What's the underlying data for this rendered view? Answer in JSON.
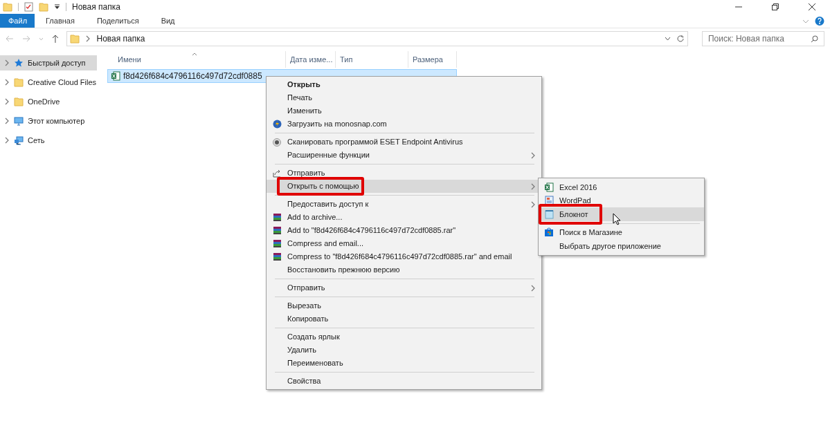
{
  "window": {
    "title": "Новая папка"
  },
  "ribbon_tabs": [
    {
      "label": "Файл",
      "selected": true
    },
    {
      "label": "Главная",
      "selected": false
    },
    {
      "label": "Поделиться",
      "selected": false
    },
    {
      "label": "Вид",
      "selected": false
    }
  ],
  "address": {
    "path": "Новая папка"
  },
  "search": {
    "placeholder": "Поиск: Новая папка"
  },
  "sidebar": {
    "items": [
      {
        "label": "Быстрый доступ",
        "selected": true
      },
      {
        "label": "Creative Cloud Files",
        "selected": false
      },
      {
        "label": "OneDrive",
        "selected": false
      },
      {
        "label": "Этот компьютер",
        "selected": false
      },
      {
        "label": "Сеть",
        "selected": false
      }
    ]
  },
  "table": {
    "columns": [
      "Имени",
      "Дата изме...",
      "Тип",
      "Размера"
    ],
    "rows": [
      {
        "name": "f8d426f684c4796116c497d72cdf0885",
        "selected": true
      }
    ]
  },
  "context_menu": {
    "items": [
      {
        "kind": "item",
        "label": "Открыть",
        "default": true,
        "selected": false,
        "submenu": false,
        "highlighted": false
      },
      {
        "kind": "item",
        "label": "Печать",
        "default": false,
        "selected": false,
        "submenu": false,
        "highlighted": false
      },
      {
        "kind": "item",
        "label": "Изменить",
        "default": false,
        "selected": false,
        "submenu": false,
        "highlighted": false
      },
      {
        "kind": "item",
        "label": "Загрузить на monosnap.com",
        "default": false,
        "selected": false,
        "submenu": false,
        "highlighted": false
      },
      {
        "kind": "separator"
      },
      {
        "kind": "item",
        "label": "Сканировать программой ESET Endpoint Antivirus",
        "default": false,
        "selected": false,
        "submenu": false,
        "highlighted": false
      },
      {
        "kind": "item",
        "label": "Расширенные функции",
        "default": false,
        "selected": false,
        "submenu": true,
        "highlighted": false
      },
      {
        "kind": "separator"
      },
      {
        "kind": "item",
        "label": "Отправить",
        "default": false,
        "selected": false,
        "submenu": false,
        "highlighted": false
      },
      {
        "kind": "item",
        "label": "Открыть с помощью",
        "default": false,
        "selected": true,
        "submenu": true,
        "highlighted": true
      },
      {
        "kind": "separator"
      },
      {
        "kind": "item",
        "label": "Предоставить доступ к",
        "default": false,
        "selected": false,
        "submenu": true,
        "highlighted": false
      },
      {
        "kind": "item",
        "label": "Add to archive...",
        "default": false,
        "selected": false,
        "submenu": false,
        "highlighted": false
      },
      {
        "kind": "item",
        "label": "Add to \"f8d426f684c4796116c497d72cdf0885.rar\"",
        "default": false,
        "selected": false,
        "submenu": false,
        "highlighted": false
      },
      {
        "kind": "item",
        "label": "Compress and email...",
        "default": false,
        "selected": false,
        "submenu": false,
        "highlighted": false
      },
      {
        "kind": "item",
        "label": "Compress to \"f8d426f684c4796116c497d72cdf0885.rar\" and email",
        "default": false,
        "selected": false,
        "submenu": false,
        "highlighted": false
      },
      {
        "kind": "item",
        "label": "Восстановить прежнюю версию",
        "default": false,
        "selected": false,
        "submenu": false,
        "highlighted": false
      },
      {
        "kind": "separator"
      },
      {
        "kind": "item",
        "label": "Отправить",
        "default": false,
        "selected": false,
        "submenu": true,
        "highlighted": false
      },
      {
        "kind": "separator"
      },
      {
        "kind": "item",
        "label": "Вырезать",
        "default": false,
        "selected": false,
        "submenu": false,
        "highlighted": false
      },
      {
        "kind": "item",
        "label": "Копировать",
        "default": false,
        "selected": false,
        "submenu": false,
        "highlighted": false
      },
      {
        "kind": "separator"
      },
      {
        "kind": "item",
        "label": "Создать ярлык",
        "default": false,
        "selected": false,
        "submenu": false,
        "highlighted": false
      },
      {
        "kind": "item",
        "label": "Удалить",
        "default": false,
        "selected": false,
        "submenu": false,
        "highlighted": false
      },
      {
        "kind": "item",
        "label": "Переименовать",
        "default": false,
        "selected": false,
        "submenu": false,
        "highlighted": false
      },
      {
        "kind": "separator"
      },
      {
        "kind": "item",
        "label": "Свойства",
        "default": false,
        "selected": false,
        "submenu": false,
        "highlighted": false
      }
    ]
  },
  "submenu": {
    "items": [
      {
        "kind": "item",
        "label": "Excel 2016",
        "selected": false,
        "highlighted": false
      },
      {
        "kind": "item",
        "label": "WordPad",
        "selected": false,
        "highlighted": false
      },
      {
        "kind": "item",
        "label": "Блокнот",
        "selected": true,
        "highlighted": true
      },
      {
        "kind": "separator"
      },
      {
        "kind": "item",
        "label": "Поиск в Магазине",
        "selected": false,
        "highlighted": false
      },
      {
        "kind": "item",
        "label": "Выбрать другое приложение",
        "selected": false,
        "highlighted": false
      }
    ]
  }
}
